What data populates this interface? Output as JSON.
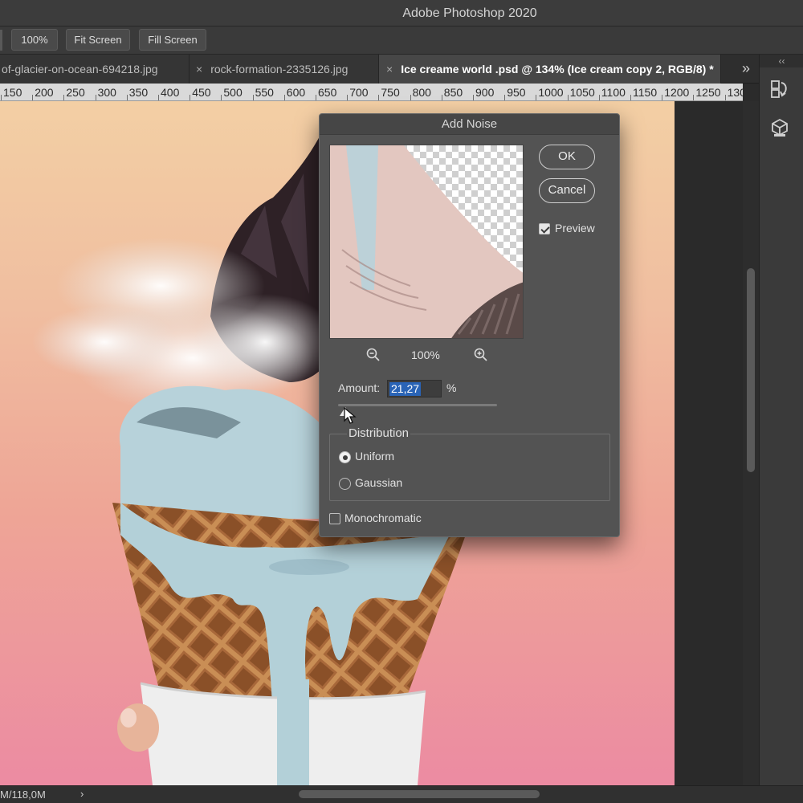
{
  "window": {
    "title": "Adobe Photoshop 2020"
  },
  "options_bar": {
    "zoom_label": "100%",
    "fit_screen_label": "Fit Screen",
    "fill_screen_label": "Fill Screen"
  },
  "tabs": [
    {
      "label": "of-glacier-on-ocean-694218.jpg",
      "active": false
    },
    {
      "close": "×",
      "label": "rock-formation-2335126.jpg",
      "active": false
    },
    {
      "close": "×",
      "label": "Ice creame world .psd @ 134% (Ice cream copy 2, RGB/8) *",
      "active": true
    }
  ],
  "tabs_overflow": "»",
  "ruler": {
    "labels": [
      "150",
      "200",
      "250",
      "300",
      "350",
      "400",
      "450",
      "500",
      "550",
      "600",
      "650",
      "700",
      "750",
      "800",
      "850",
      "900",
      "950",
      "1000",
      "1050",
      "1100",
      "1150",
      "1200",
      "1250",
      "130"
    ]
  },
  "dialog": {
    "title": "Add Noise",
    "ok_label": "OK",
    "cancel_label": "Cancel",
    "preview_label": "Preview",
    "preview_checked": true,
    "zoom_level": "100%",
    "amount_label": "Amount:",
    "amount_value": "21,27",
    "amount_unit": "%",
    "distribution_label": "Distribution",
    "uniform_label": "Uniform",
    "gaussian_label": "Gaussian",
    "selected_distribution": "Uniform",
    "monochromatic_label": "Monochromatic",
    "monochromatic_checked": false
  },
  "status_bar": {
    "doc_size": "M/118,0M",
    "arrow": "›"
  },
  "colors": {
    "canvas_top": "#f3cfa4",
    "canvas_bottom": "#ec8ba2",
    "selection_blue": "#2a64b6",
    "dialog_bg": "#535353"
  }
}
